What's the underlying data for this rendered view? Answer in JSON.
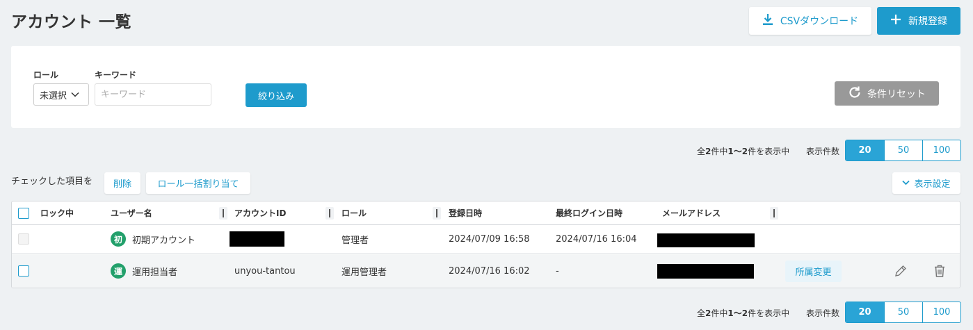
{
  "header": {
    "title": "アカウント 一覧",
    "csv_label": "CSVダウンロード",
    "new_label": "新規登録"
  },
  "filter": {
    "role_label": "ロール",
    "role_value": "未選択",
    "keyword_label": "キーワード",
    "keyword_placeholder": "キーワード",
    "keyword_value": "",
    "filter_button": "絞り込み",
    "reset_button": "条件リセット"
  },
  "pagination": {
    "prefix": "全",
    "total": "2",
    "mid": "件中",
    "range": "1〜2",
    "suffix": "件を表示中",
    "per_page_label": "表示件数",
    "options": [
      "20",
      "50",
      "100"
    ],
    "active": "20"
  },
  "bulk": {
    "label": "チェックした項目を",
    "delete_button": "削除",
    "assign_role_button": "ロール一括割り当て",
    "display_settings": "表示設定"
  },
  "table": {
    "columns": {
      "lock": "ロック中",
      "user": "ユーザー名",
      "account_id": "アカウントID",
      "role": "ロール",
      "registered": "登録日時",
      "last_login": "最終ログイン日時",
      "email": "メールアドレス"
    },
    "rows": [
      {
        "avatar": "初",
        "user": "初期アカウント",
        "account_id": "",
        "role": "管理者",
        "registered": "2024/07/09 16:58",
        "last_login": "2024/07/16 16:04",
        "email": ""
      },
      {
        "avatar": "運",
        "user": "運用担当者",
        "account_id": "unyou-tantou",
        "role": "運用管理者",
        "registered": "2024/07/16 16:02",
        "last_login": "-",
        "email": "",
        "affiliation_button": "所属変更"
      }
    ]
  },
  "icons": {
    "download": "download-icon",
    "plus": "plus-icon",
    "reset": "refresh-icon",
    "chevron": "chevron-down-icon",
    "edit": "pencil-icon",
    "delete": "trash-icon"
  },
  "colors": {
    "accent": "#1e9bcc",
    "avatar": "#22a06b",
    "reset_button": "#999999"
  }
}
